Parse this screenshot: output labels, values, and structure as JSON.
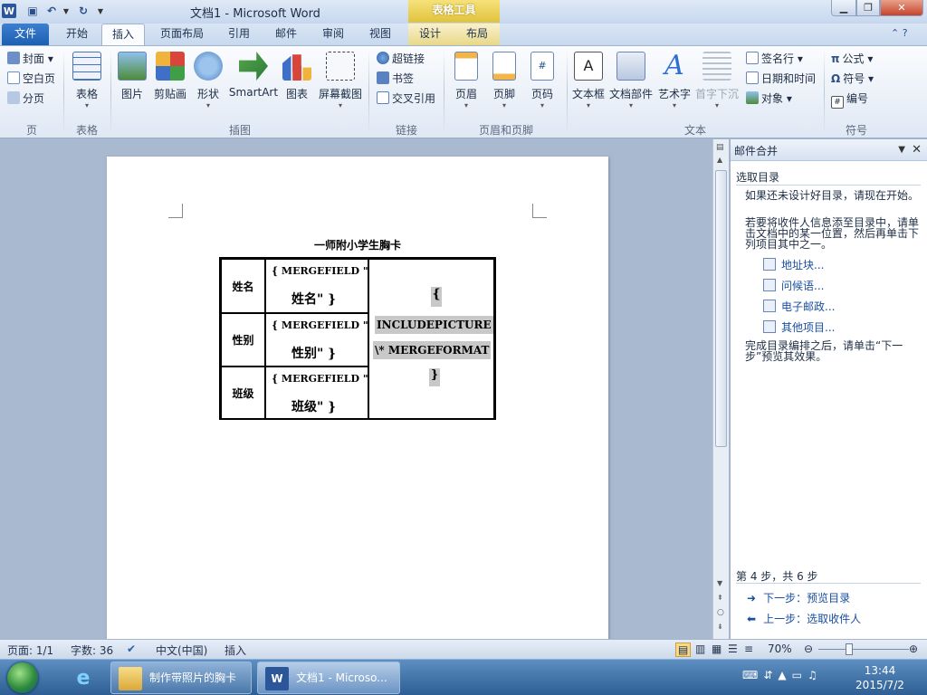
{
  "title_bar": {
    "doc_title": "文档1  -  Microsoft Word",
    "context_tab_title": "表格工具"
  },
  "tabs": {
    "file": "文件",
    "home": "开始",
    "insert": "插入",
    "page_layout": "页面布局",
    "references": "引用",
    "mailings": "邮件",
    "review": "审阅",
    "view": "视图",
    "design": "设计",
    "layout": "布局"
  },
  "ribbon": {
    "pages": {
      "cover": "封面",
      "blank": "空白页",
      "break": "分页",
      "group": "页"
    },
    "tables": {
      "table": "表格",
      "group": "表格"
    },
    "illustrations": {
      "picture": "图片",
      "clipart": "剪贴画",
      "shapes": "形状",
      "smartart": "SmartArt",
      "chart": "图表",
      "screenshot": "屏幕截图",
      "group": "插图"
    },
    "links": {
      "hyperlink": "超链接",
      "bookmark": "书签",
      "crossref": "交叉引用",
      "group": "链接"
    },
    "header_footer": {
      "header": "页眉",
      "footer": "页脚",
      "page_number": "页码",
      "group": "页眉和页脚"
    },
    "text": {
      "textbox": "文本框",
      "quickparts": "文档部件",
      "wordart": "艺术字",
      "dropcap": "首字下沉",
      "signature": "签名行",
      "datetime": "日期和时间",
      "object": "对象",
      "group": "文本"
    },
    "symbols": {
      "equation": "公式",
      "symbol": "符号",
      "number": "编号",
      "group": "符号"
    }
  },
  "document": {
    "heading": "一师附小学生胸卡",
    "rows": [
      {
        "label": "姓名",
        "field_line1": "{ MERGEFIELD \"",
        "field_line2": "姓名\" }"
      },
      {
        "label": "性别",
        "field_line1": "{ MERGEFIELD \"",
        "field_line2": "性别\" }"
      },
      {
        "label": "班级",
        "field_line1": "{ MERGEFIELD \"",
        "field_line2": "班级\" }"
      }
    ],
    "photo_field": {
      "open": "{",
      "line1": "INCLUDEPICTURE",
      "line2": "\\* MERGEFORMAT",
      "close": "}"
    }
  },
  "task_pane": {
    "title": "邮件合并",
    "section": "选取目录",
    "intro1": "如果还未设计好目录，请现在开始。",
    "intro2": "若要将收件人信息添至目录中，请单击文档中的某一位置，然后再单击下列项目其中之一。",
    "links": [
      "地址块...",
      "问候语...",
      "电子邮政...",
      "其他项目..."
    ],
    "outro": "完成目录编排之后，请单击“下一步”预览其效果。",
    "step": "第 4 步，共 6 步",
    "next": "下一步：预览目录",
    "prev": "上一步：选取收件人"
  },
  "status_bar": {
    "page": "页面: 1/1",
    "words": "字数: 36",
    "language": "中文(中国)",
    "mode": "插入",
    "zoom": "70%"
  },
  "taskbar": {
    "folder_window": "制作带照片的胸卡",
    "word_window": "文档1 - Microso...",
    "time": "13:44",
    "date": "2015/7/2"
  }
}
